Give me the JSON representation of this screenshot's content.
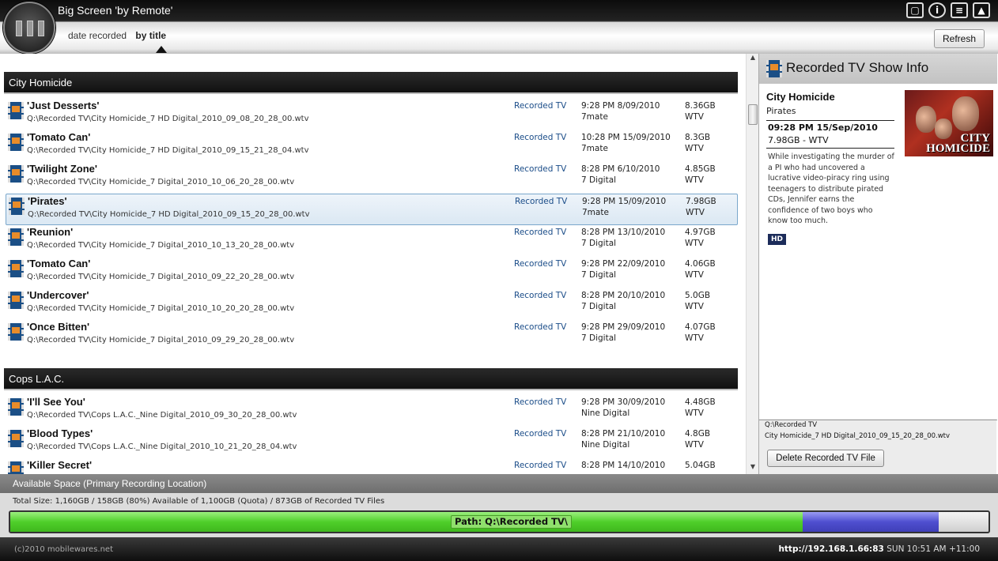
{
  "app": {
    "title": "Big Screen 'by Remote'",
    "sort_options": [
      "date recorded",
      "by title"
    ],
    "active_sort": "by title",
    "refresh_label": "Refresh"
  },
  "groups": [
    {
      "name": "City Homicide",
      "recordings": [
        {
          "title": "'Just Desserts'",
          "path": "Q:\\Recorded TV\\City Homicide_7 HD Digital_2010_09_08_20_28_00.wtv",
          "type": "Recorded TV",
          "time": "9:28 PM 8/09/2010",
          "channel": "7mate",
          "size": "8.36GB",
          "format": "WTV"
        },
        {
          "title": "'Tomato Can'",
          "path": "Q:\\Recorded TV\\City Homicide_7 HD Digital_2010_09_15_21_28_04.wtv",
          "type": "Recorded TV",
          "time": "10:28 PM 15/09/2010",
          "channel": "7mate",
          "size": "8.3GB",
          "format": "WTV"
        },
        {
          "title": "'Twilight Zone'",
          "path": "Q:\\Recorded TV\\City Homicide_7 Digital_2010_10_06_20_28_00.wtv",
          "type": "Recorded TV",
          "time": "8:28 PM 6/10/2010",
          "channel": "7 Digital",
          "size": "4.85GB",
          "format": "WTV"
        },
        {
          "title": "'Pirates'",
          "path": "Q:\\Recorded TV\\City Homicide_7 HD Digital_2010_09_15_20_28_00.wtv",
          "type": "Recorded TV",
          "time": "9:28 PM 15/09/2010",
          "channel": "7mate",
          "size": "7.98GB",
          "format": "WTV",
          "selected": true
        },
        {
          "title": "'Reunion'",
          "path": "Q:\\Recorded TV\\City Homicide_7 Digital_2010_10_13_20_28_00.wtv",
          "type": "Recorded TV",
          "time": "8:28 PM 13/10/2010",
          "channel": "7 Digital",
          "size": "4.97GB",
          "format": "WTV"
        },
        {
          "title": "'Tomato Can'",
          "path": "Q:\\Recorded TV\\City Homicide_7 Digital_2010_09_22_20_28_00.wtv",
          "type": "Recorded TV",
          "time": "9:28 PM 22/09/2010",
          "channel": "7 Digital",
          "size": "4.06GB",
          "format": "WTV"
        },
        {
          "title": "'Undercover'",
          "path": "Q:\\Recorded TV\\City Homicide_7 Digital_2010_10_20_20_28_00.wtv",
          "type": "Recorded TV",
          "time": "8:28 PM 20/10/2010",
          "channel": "7 Digital",
          "size": "5.0GB",
          "format": "WTV"
        },
        {
          "title": "'Once Bitten'",
          "path": "Q:\\Recorded TV\\City Homicide_7 Digital_2010_09_29_20_28_00.wtv",
          "type": "Recorded TV",
          "time": "9:28 PM 29/09/2010",
          "channel": "7 Digital",
          "size": "4.07GB",
          "format": "WTV"
        }
      ]
    },
    {
      "name": "Cops L.A.C.",
      "recordings": [
        {
          "title": "'I'll See You'",
          "path": "Q:\\Recorded TV\\Cops L.A.C._Nine Digital_2010_09_30_20_28_00.wtv",
          "type": "Recorded TV",
          "time": "9:28 PM 30/09/2010",
          "channel": "Nine Digital",
          "size": "4.48GB",
          "format": "WTV"
        },
        {
          "title": "'Blood Types'",
          "path": "Q:\\Recorded TV\\Cops L.A.C._Nine Digital_2010_10_21_20_28_04.wtv",
          "type": "Recorded TV",
          "time": "8:28 PM 21/10/2010",
          "channel": "Nine Digital",
          "size": "4.8GB",
          "format": "WTV"
        },
        {
          "title": "'Killer Secret'",
          "path": "",
          "type": "Recorded TV",
          "time": "8:28 PM 14/10/2010",
          "channel": "",
          "size": "5.04GB",
          "format": ""
        }
      ]
    }
  ],
  "info": {
    "panel_title": "Recorded TV Show Info",
    "show_name": "City Homicide",
    "episode": "Pirates",
    "time": "09:28 PM  15/Sep/2010",
    "size_format": "7.98GB - WTV",
    "description": "While investigating the murder of a PI who had uncovered a lucrative video-piracy ring using teenagers to distribute pirated CDs, Jennifer earns the confidence of two boys who know too much.",
    "badge": "HD",
    "poster_text_1": "CITY",
    "poster_text_2": "HOMICIDE",
    "file_dir": "Q:\\Recorded TV",
    "file_name": "City Homicide_7 HD Digital_2010_09_15_20_28_00.wtv",
    "delete_label": "Delete Recorded TV File"
  },
  "space": {
    "header": "Available Space (Primary Recording Location)",
    "summary": "Total Size: 1,160GB  / 158GB (80%) Available of 1,100GB (Quota) / 873GB of Recorded TV Files",
    "bar_label": "Path: Q:\\Recorded TV\\",
    "recorded_tv_fraction": 0.81,
    "other_used_fraction": 0.139,
    "colors": {
      "recorded": "#4fcf2a",
      "other": "#4f4fd0",
      "free": "#e0e0e0"
    }
  },
  "footer": {
    "copyright": "(c)2010 mobilewares.net",
    "url": "http://192.168.1.66:83",
    "clock": "SUN 10:51 AM +11:00"
  },
  "icons": [
    "app-logo-icon",
    "screen-icon",
    "info-icon",
    "list-icon",
    "plug-icon",
    "film-icon"
  ]
}
